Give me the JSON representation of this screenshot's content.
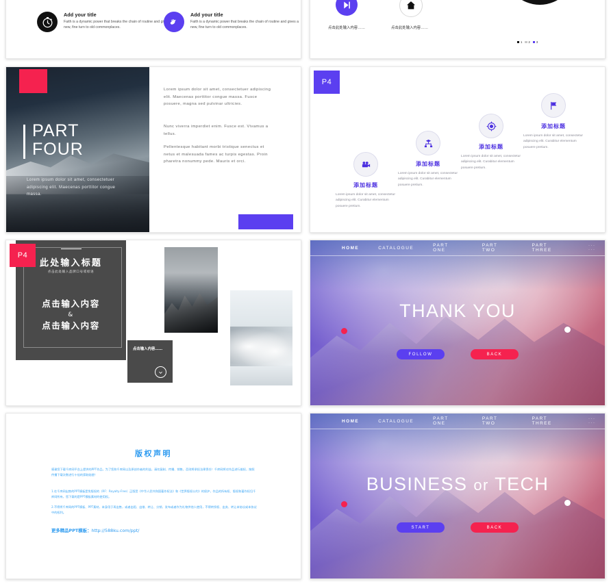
{
  "slide_icon_blurbs": {
    "items": [
      {
        "icon": "stopwatch-icon",
        "title": "Add your title",
        "body": "Faith is a dynamic power that breaks the chain of routine and gives a new, fine turn to old commonplaces."
      },
      {
        "icon": "hand-gesture-icon",
        "title": "Add your title",
        "body": "Faith is a dynamic power that breaks the chain of routine and gives a new, fine turn to old commonplaces."
      }
    ]
  },
  "slide_icons_chart": {
    "buttons": [
      {
        "icon": "play-pause-icon",
        "caption": "点击此处输入内容……"
      },
      {
        "icon": "home-icon",
        "caption": "点击此处输入内容……"
      }
    ],
    "legend": [
      {
        "label": "1",
        "color": "#111111"
      },
      {
        "label": "2",
        "color": "#c9c9c9"
      },
      {
        "label": "3",
        "color": "#5B3FF0"
      }
    ],
    "chart_data": {
      "type": "pie",
      "title": "",
      "categories": [
        "1",
        "2",
        "3"
      ],
      "values": [
        76,
        17,
        7
      ],
      "colors": [
        "#111111",
        "#c9c9c9",
        "#5B3FF0"
      ],
      "legend_position": "bottom",
      "donut": true
    }
  },
  "slide_part_four": {
    "badge_color": "#F5224F",
    "title_line1": "PART",
    "title_line2": "FOUR",
    "subtitle": "Lorem ipsum dolor sit amet, consectetuer adipiscing elit. Maecenas porttitor congue massa.",
    "paragraphs": [
      "Lorem ipsum dolor sit amet, consectetuer adipiscing elit. Maecenas porttitor congue massa. Fusce posuere, magna sed pulvinar ultricies.",
      "Nunc viverra imperdiet enim. Fusce est. Vivamus a tellus.",
      "Pellentesque habitant morbi tristique senectus et netus et malesuada fames ac turpis egestas. Proin pharetra nonummy pede. Mauris et orci."
    ],
    "accent_color": "#5B3FF0"
  },
  "slide_p4_steps": {
    "badge": "P4",
    "badge_color": "#5B3FF0",
    "steps": [
      {
        "icon": "movie-camera-icon",
        "heading": "添加标题",
        "body": "Lorem ipsum dolor sit amet, consectetur adipiscing elit. Curabitur elementum posuere pretium."
      },
      {
        "icon": "org-chart-icon",
        "heading": "添加标题",
        "body": "Lorem ipsum dolor sit amet, consectetur adipiscing elit. Curabitur elementum posuere pretium."
      },
      {
        "icon": "target-icon",
        "heading": "添加标题",
        "body": "Lorem ipsum dolor sit amet, consectetur adipiscing elit. Curabitur elementum posuere pretium."
      },
      {
        "icon": "flag-icon",
        "heading": "添加标题",
        "body": "Lorem ipsum dolor sit amet, consectetur adipiscing elit. Curabitur elementum posuere pretium."
      }
    ]
  },
  "slide_dark_panel": {
    "badge": "P4",
    "badge_color": "#F5224F",
    "heading": "此处输入标题",
    "subheading": "点击此处输入品牌口号或标语",
    "big_line1": "点击输入内容",
    "big_amp": "&",
    "big_line2": "点击输入内容",
    "card_text": "点击输入内容……",
    "card_arrow_icon": "arrow-down-circle-icon"
  },
  "slide_thank_you": {
    "nav": [
      "HOME",
      "CATALOGUE",
      "PART ONE",
      "PART TWO",
      "PART THREE"
    ],
    "nav_more": "···  ···",
    "title": "THANK YOU",
    "buttons": [
      {
        "label": "FOLLOW",
        "color": "#5B3FF0"
      },
      {
        "label": "BACK",
        "color": "#F5224F"
      }
    ]
  },
  "slide_business_tech": {
    "nav": [
      "HOME",
      "CATALOGUE",
      "PART ONE",
      "PART TWO",
      "PART THREE"
    ],
    "nav_more": "···  ···",
    "title_main": "BUSINESS",
    "title_conj": "or",
    "title_tail": "TECH",
    "buttons": [
      {
        "label": "START",
        "color": "#5B3FF0"
      },
      {
        "label": "BACK",
        "color": "#F5224F"
      }
    ]
  },
  "slide_copyright": {
    "title": "版权声明",
    "paragraph1": "感谢您下载千库网平台上提供的PPT作品，为了您和千库网以及原创作者的利益，请勿复制、传播、销售，否则将承担法律责任！千库网将对作品进行维权，按照传播下载次数进行十倍的索取赔偿！",
    "paragraph2": "1.在千库网出售的PPT模板是免版权的（RF：Royalty-Free）正版受《中华人民共和国著作权法》和《世界版权公约》的保护，作品的所有权、版权和著作权归千库网所有，您下载的是PPT模板素材的使用权。",
    "paragraph3": "2.不得将千库网的PPT模板、PPT素材，本身用于再出售，或者出租、出借、转让、分销、发布或者作为礼物供他人使用，不得转授权、出卖、转让本协议或本协议中的权利。",
    "link_label": "更多精品PPT模板：",
    "link_url": "http://588ku.com/ppt/"
  }
}
